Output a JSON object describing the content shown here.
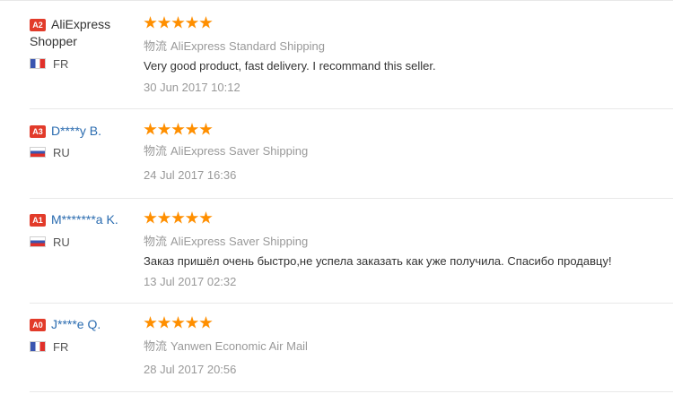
{
  "reviews": [
    {
      "level": "A2",
      "name": "AliExpress Shopper",
      "country": "FR",
      "flag": "fr",
      "rating": 5,
      "shipping_label": "物流",
      "shipping": "AliExpress Standard Shipping",
      "feedback": "Very good product, fast delivery. I recommand this seller.",
      "date": "30 Jun 2017 10:12"
    },
    {
      "level": "A3",
      "name": "D****y B.",
      "country": "RU",
      "flag": "ru",
      "rating": 5,
      "shipping_label": "物流",
      "shipping": "AliExpress Saver Shipping",
      "feedback": "",
      "date": "24 Jul 2017 16:36"
    },
    {
      "level": "A1",
      "name": "M*******a K.",
      "country": "RU",
      "flag": "ru",
      "rating": 5,
      "shipping_label": "物流",
      "shipping": "AliExpress Saver Shipping",
      "feedback": "Заказ пришёл очень быстро,не успела заказать как уже получила. Спасибо продавцу!",
      "date": "13 Jul 2017 02:32"
    },
    {
      "level": "A0",
      "name": "J****e Q.",
      "country": "FR",
      "flag": "fr",
      "rating": 5,
      "shipping_label": "物流",
      "shipping": "Yanwen Economic Air Mail",
      "feedback": "",
      "date": "28 Jul 2017 20:56"
    }
  ],
  "colors": {
    "badge": "#e23b2a",
    "star": "#ff8f00",
    "link": "#2b6cb0",
    "muted": "#999999"
  }
}
